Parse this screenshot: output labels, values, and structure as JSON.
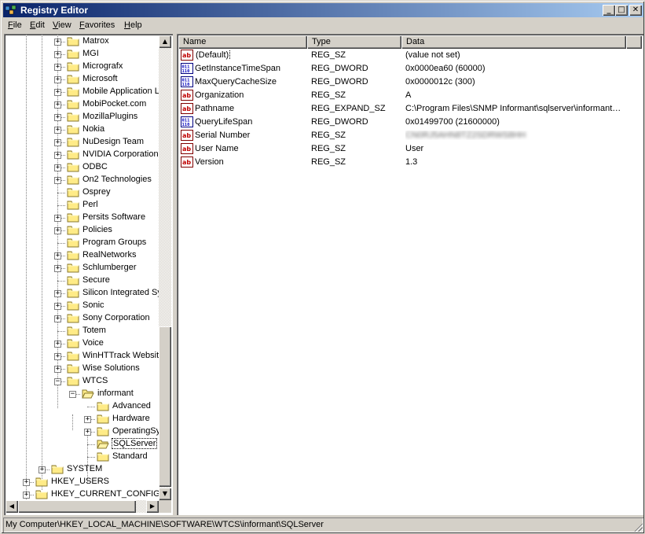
{
  "window": {
    "title": "Registry Editor",
    "minimize_label": "_",
    "maximize_label": "□",
    "close_label": "✕"
  },
  "menu": [
    "File",
    "Edit",
    "View",
    "Favorites",
    "Help"
  ],
  "tree": [
    {
      "label": "Matrox",
      "level": 3,
      "expander": "+"
    },
    {
      "label": "MGI",
      "level": 3,
      "expander": "+"
    },
    {
      "label": "Micrografx",
      "level": 3,
      "expander": "+"
    },
    {
      "label": "Microsoft",
      "level": 3,
      "expander": "+"
    },
    {
      "label": "Mobile Application Lin",
      "level": 3,
      "expander": "+"
    },
    {
      "label": "MobiPocket.com",
      "level": 3,
      "expander": "+"
    },
    {
      "label": "MozillaPlugins",
      "level": 3,
      "expander": "+"
    },
    {
      "label": "Nokia",
      "level": 3,
      "expander": "+"
    },
    {
      "label": "NuDesign Team",
      "level": 3,
      "expander": "+"
    },
    {
      "label": "NVIDIA Corporation",
      "level": 3,
      "expander": "+"
    },
    {
      "label": "ODBC",
      "level": 3,
      "expander": "+"
    },
    {
      "label": "On2 Technologies",
      "level": 3,
      "expander": "+"
    },
    {
      "label": "Osprey",
      "level": 3,
      "expander": ""
    },
    {
      "label": "Perl",
      "level": 3,
      "expander": ""
    },
    {
      "label": "Persits Software",
      "level": 3,
      "expander": "+"
    },
    {
      "label": "Policies",
      "level": 3,
      "expander": "+"
    },
    {
      "label": "Program Groups",
      "level": 3,
      "expander": ""
    },
    {
      "label": "RealNetworks",
      "level": 3,
      "expander": "+"
    },
    {
      "label": "Schlumberger",
      "level": 3,
      "expander": "+"
    },
    {
      "label": "Secure",
      "level": 3,
      "expander": ""
    },
    {
      "label": "Silicon Integrated Sy",
      "level": 3,
      "expander": "+"
    },
    {
      "label": "Sonic",
      "level": 3,
      "expander": "+"
    },
    {
      "label": "Sony Corporation",
      "level": 3,
      "expander": "+"
    },
    {
      "label": "Totem",
      "level": 3,
      "expander": ""
    },
    {
      "label": "Voice",
      "level": 3,
      "expander": "+"
    },
    {
      "label": "WinHTTrack Website",
      "level": 3,
      "expander": "+"
    },
    {
      "label": "Wise Solutions",
      "level": 3,
      "expander": "+"
    },
    {
      "label": "WTCS",
      "level": 3,
      "expander": "-"
    },
    {
      "label": "informant",
      "level": 4,
      "expander": "-",
      "open": true
    },
    {
      "label": "Advanced",
      "level": 5,
      "expander": ""
    },
    {
      "label": "Hardware",
      "level": 5,
      "expander": "+"
    },
    {
      "label": "OperatingSy",
      "level": 5,
      "expander": "+"
    },
    {
      "label": "SQLServer",
      "level": 5,
      "expander": "",
      "open": true,
      "selected": true
    },
    {
      "label": "Standard",
      "level": 5,
      "expander": ""
    },
    {
      "label": "SYSTEM",
      "level": 2,
      "expander": "+"
    },
    {
      "label": "HKEY_USERS",
      "level": 1,
      "expander": "+"
    },
    {
      "label": "HKEY_CURRENT_CONFIG",
      "level": 1,
      "expander": "+"
    }
  ],
  "columns": [
    "Name",
    "Type",
    "Data"
  ],
  "values": [
    {
      "name": "(Default)",
      "type": "REG_SZ",
      "data": "(value not set)",
      "icon": "string-value-icon",
      "focused": true
    },
    {
      "name": "GetInstanceTimeSpan",
      "type": "REG_DWORD",
      "data": "0x0000ea60 (60000)",
      "icon": "binary-value-icon"
    },
    {
      "name": "MaxQueryCacheSize",
      "type": "REG_DWORD",
      "data": "0x0000012c (300)",
      "icon": "binary-value-icon"
    },
    {
      "name": "Organization",
      "type": "REG_SZ",
      "data": "A",
      "icon": "string-value-icon"
    },
    {
      "name": "Pathname",
      "type": "REG_EXPAND_SZ",
      "data": "C:\\Program Files\\SNMP Informant\\sqlserver\\informant…",
      "icon": "string-value-icon"
    },
    {
      "name": "QueryLifeSpan",
      "type": "REG_DWORD",
      "data": "0x01499700 (21600000)",
      "icon": "binary-value-icon"
    },
    {
      "name": "Serial Number",
      "type": "REG_SZ",
      "data": "CN0RJ5AHN8TZ2SDRWS8HH",
      "icon": "string-value-icon",
      "blurred": true
    },
    {
      "name": "User Name",
      "type": "REG_SZ",
      "data": "User",
      "icon": "string-value-icon"
    },
    {
      "name": "Version",
      "type": "REG_SZ",
      "data": "1.3",
      "icon": "string-value-icon"
    }
  ],
  "status": "My Computer\\HKEY_LOCAL_MACHINE\\SOFTWARE\\WTCS\\informant\\SQLServer"
}
